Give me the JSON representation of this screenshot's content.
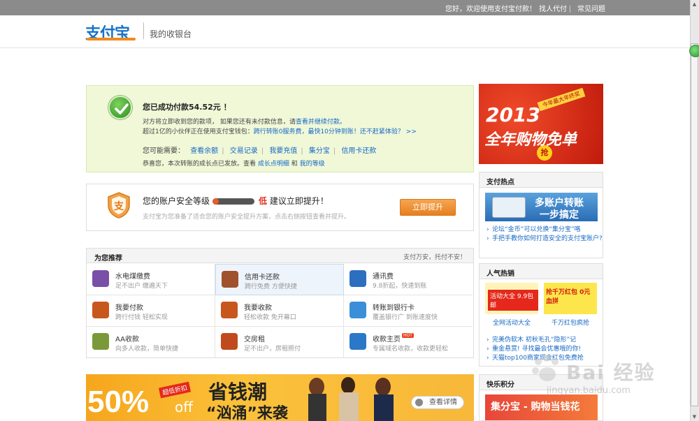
{
  "topbar": {
    "greeting": "您好，欢迎使用支付宝付款！",
    "link1": "找人代付",
    "link2": "常见问题"
  },
  "header": {
    "logo_text": "支付宝",
    "title": "我的收银台"
  },
  "success": {
    "title_prefix": "您已成功付款",
    "amount": "54.52元 ！",
    "line1_text": "对方将立即收到您的款项，  如果您还有未付款信息，请",
    "line1_link": "查看并继续付款。",
    "line2_text": "超过1亿的小伙伴正在使用支付宝钱包：",
    "line2_link": "跨行转账0服务费，最快10分钟到账！还不赶紧体验？ >>",
    "need_label": "您可能需要：",
    "need_links": [
      "查看余额",
      "交易记录",
      "我要充值",
      "集分宝",
      "信用卡还款"
    ],
    "points_text": "恭喜您，本次转账的成长点已发放。查看",
    "points_link1": "成长点明细",
    "points_and": "和",
    "points_link2": "我的等级"
  },
  "security": {
    "title": "您的账户安全等级",
    "level": "低",
    "level_fraction": 0.15,
    "advice": "建议立即提升！",
    "subtitle": "支付宝为您准备了适合您的账户安全提升方案，点击右侧按钮查看并提升。",
    "button": "立即提升"
  },
  "recommend": {
    "title": "为您推荐",
    "slogan": "支付万安，托付不安！",
    "items": [
      {
        "name": "水电煤缴费",
        "desc": "足不出户 缴遍天下",
        "color": "#7a4fa8"
      },
      {
        "name": "信用卡还款",
        "desc": "跨行免费 方便快捷",
        "color": "#a0522d"
      },
      {
        "name": "通讯费",
        "desc": "9.8折起，快速到账",
        "color": "#2c6fc0"
      },
      {
        "name": "我要付款",
        "desc": "跨行付钱 轻松实现",
        "color": "#c8571e"
      },
      {
        "name": "我要收款",
        "desc": "轻松收款 免开幕口",
        "color": "#c8571e"
      },
      {
        "name": "转账到银行卡",
        "desc": "覆盖银行广 到账速度快",
        "color": "#3a8fd8"
      },
      {
        "name": "AA收款",
        "desc": "向多人收款，简单快捷",
        "color": "#7a9a3a"
      },
      {
        "name": "交房租",
        "desc": "足不出户，房租照付",
        "color": "#c04a1e"
      },
      {
        "name": "收款主页",
        "desc": "专属域名收款，收款更轻松",
        "color": "#2c78c8"
      }
    ],
    "hot_badge": "HOT"
  },
  "bottom_banner": {
    "big": "50%",
    "off": "off",
    "tag": "超低折扣",
    "line1": "省钱潮",
    "line2": "“汹涌”来袭",
    "button": "查看详情"
  },
  "promo2013": {
    "ribbon": "今年最大年终奖",
    "year": "2013",
    "text": "全年购物免单",
    "icon": "抢"
  },
  "hot_topics": {
    "title": "支付热点",
    "banner_line1": "多账户转账",
    "banner_line2": "一步搞定",
    "links": [
      "论坛“金币”可以兑换“集分宝”咯",
      "手把手教你如何打造安全的支付宝账户?"
    ]
  },
  "popular": {
    "title": "人气热销",
    "items": [
      {
        "caption": "全网活动大全",
        "img_text": "活动大全 9.9包邮"
      },
      {
        "caption": "千万红包疯抢",
        "img_text": "抢千万红包 0元血拼"
      }
    ],
    "links": [
      "完美伪软木 初秋毛孔“隐形”记",
      "重金悬赏! 寻找最会优惠哦的你!",
      "天猫top100商家现金红包免费抢"
    ]
  },
  "happy": {
    "title": "快乐积分",
    "banner": "集分宝 - 购物当钱花"
  },
  "watermark": {
    "text": "Bai 经验",
    "url": "jingyan.baidu.com"
  }
}
